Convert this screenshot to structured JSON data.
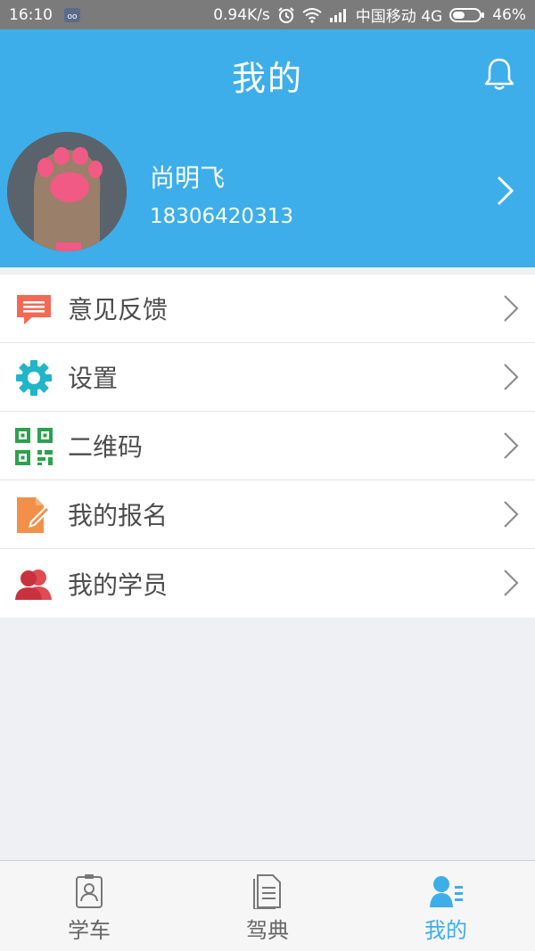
{
  "status_bar": {
    "time": "16:10",
    "net_speed": "0.94K/s",
    "carrier": "中国移动 4G",
    "battery": "46%",
    "battery_level": 0.46
  },
  "header": {
    "title": "我的",
    "bell_icon": "bell-icon"
  },
  "profile": {
    "name": "尚明飞",
    "phone": "18306420313"
  },
  "menu": {
    "items": [
      {
        "label": "意见反馈",
        "icon": "feedback-icon",
        "color": "#f26a55"
      },
      {
        "label": "设置",
        "icon": "gear-icon",
        "color": "#20b5c9"
      },
      {
        "label": "二维码",
        "icon": "qr-code-icon",
        "color": "#2ba24c"
      },
      {
        "label": "我的报名",
        "icon": "edit-form-icon",
        "color": "#f2904a"
      },
      {
        "label": "我的学员",
        "icon": "students-icon",
        "color": "#e04a52"
      }
    ]
  },
  "bottom_nav": {
    "items": [
      {
        "label": "学车",
        "icon": "id-card-icon",
        "active": false
      },
      {
        "label": "驾典",
        "icon": "document-icon",
        "active": false
      },
      {
        "label": "我的",
        "icon": "user-list-icon",
        "active": true
      }
    ]
  },
  "colors": {
    "primary": "#3daee9",
    "background": "#eff0f4",
    "text": "#4d4d4d"
  }
}
